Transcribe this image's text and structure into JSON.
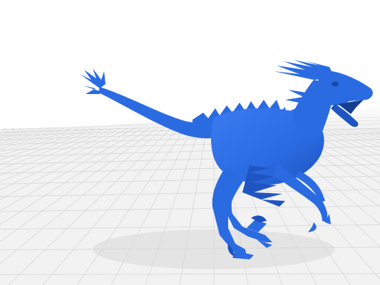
{
  "scene": {
    "subject": "raptor-model",
    "background_color": "#ffffff",
    "floor_color": "#f2f2f2",
    "grid_line_color": "#d6d6d6",
    "model_color": "#2a6be2",
    "model_shadow_color": "#1f55c2",
    "model_highlight_color": "#4d86f0"
  }
}
